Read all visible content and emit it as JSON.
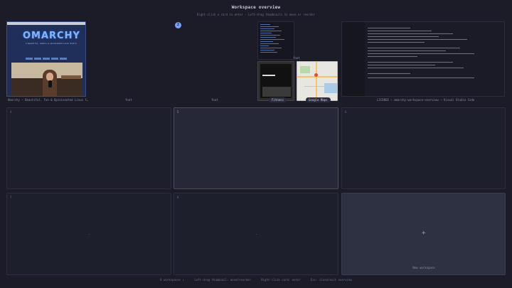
{
  "header": {
    "title": "Workspace overview",
    "subtitle": "Right-click a card to enter   ·   Left-drag thumbnails to move or reorder"
  },
  "windows": {
    "browser": {
      "label": "Omarchy — Beautiful, Fun & Opinionated Linux f…",
      "logo": "OMARCHY",
      "tagline": "a beautiful, modern & opinionated Linux distro"
    },
    "terminal": {
      "label": "foot"
    },
    "foot_mid": {
      "label": "foot"
    },
    "foot_right": {
      "label": "foot"
    },
    "phone": {
      "label": "Fitness"
    },
    "map": {
      "label": "Google Maps"
    },
    "editor": {
      "label": "LICENSE — omarchy-workspace-overview — Visual Studio Code"
    }
  },
  "workspaces": [
    {
      "num": "4"
    },
    {
      "num": "5"
    },
    {
      "num": "6"
    },
    {
      "num": "7"
    },
    {
      "num": "8"
    }
  ],
  "badge": "2",
  "new_workspace": {
    "label": "New workspace",
    "icon": "plus-icon"
  },
  "footer": [
    "8 workspaces ↕",
    "Left-drag thumbnail: move/reorder",
    "Right-click card: enter",
    "Esc: close/exit overview"
  ],
  "colors": {
    "accent": "#7aa2f7",
    "background": "#1c1c28"
  }
}
